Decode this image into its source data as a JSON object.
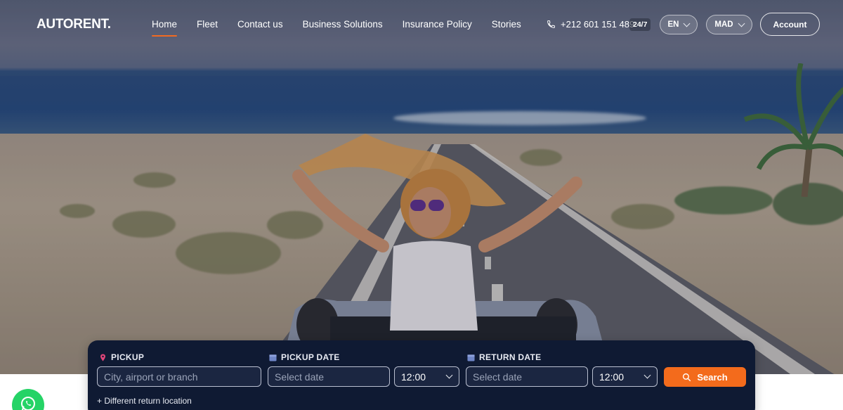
{
  "brand": {
    "logo_text": "AUTORENT."
  },
  "nav": {
    "links": [
      {
        "label": "Home",
        "active": true
      },
      {
        "label": "Fleet",
        "active": false
      },
      {
        "label": "Contact us",
        "active": false
      },
      {
        "label": "Business Solutions",
        "active": false
      },
      {
        "label": "Insurance Policy",
        "active": false
      },
      {
        "label": "Stories",
        "active": false
      }
    ],
    "phone": "+212 601 151 489",
    "availability": "24/7",
    "language": "EN",
    "currency": "MAD",
    "account_label": "Account"
  },
  "search": {
    "pickup_label": "PICKUP",
    "pickup_placeholder": "City, airport or branch",
    "pickup_date_label": "PICKUP DATE",
    "pickup_date_placeholder": "Select date",
    "pickup_time": "12:00",
    "return_date_label": "RETURN DATE",
    "return_date_placeholder": "Select date",
    "return_time": "12:00",
    "search_label": "Search",
    "different_return": "+ Different return location"
  },
  "colors": {
    "accent": "#f26a21",
    "panel": "#0f1a33",
    "whatsapp": "#25d366",
    "pin": "#e0467a",
    "calendar": "#6f86c8"
  },
  "icons": [
    "phone-icon",
    "chevron-down-icon",
    "map-pin-icon",
    "calendar-icon",
    "search-icon",
    "whatsapp-icon"
  ]
}
